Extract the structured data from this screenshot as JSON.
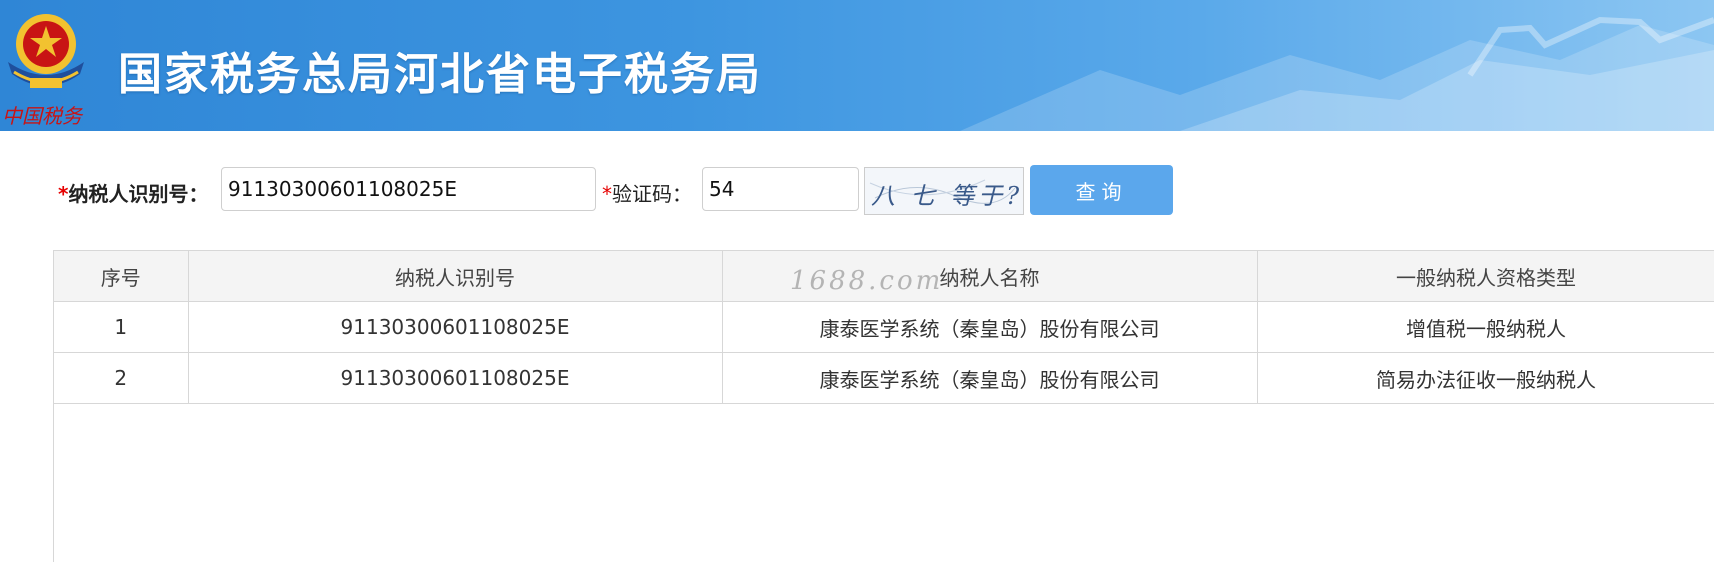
{
  "header": {
    "title": "国家税务总局河北省电子税务局",
    "emblem_caption": "中国税务"
  },
  "form": {
    "taxpayer_id_required_mark": "*",
    "taxpayer_id_label": "纳税人识别号：",
    "taxpayer_id_value": "91130300601108025E",
    "captcha_required_mark": "*",
    "captcha_label": "验证码：",
    "captcha_value": "54",
    "captcha_image_text": "八 七 等于?",
    "query_button": "查询"
  },
  "table": {
    "columns": [
      "序号",
      "纳税人识别号",
      "纳税人名称",
      "一般纳税人资格类型"
    ],
    "rows": [
      [
        "1",
        "91130300601108025E",
        "康泰医学系统（秦皇岛）股份有限公司",
        "增值税一般纳税人"
      ],
      [
        "2",
        "91130300601108025E",
        "康泰医学系统（秦皇岛）股份有限公司",
        "简易办法征收一般纳税人"
      ]
    ]
  },
  "watermark": "1688.com",
  "colors": {
    "banner": "#3d95e0",
    "button": "#5ba7ec",
    "required": "#e60000",
    "emblem_red": "#c81414",
    "emblem_gold": "#f2c230"
  }
}
